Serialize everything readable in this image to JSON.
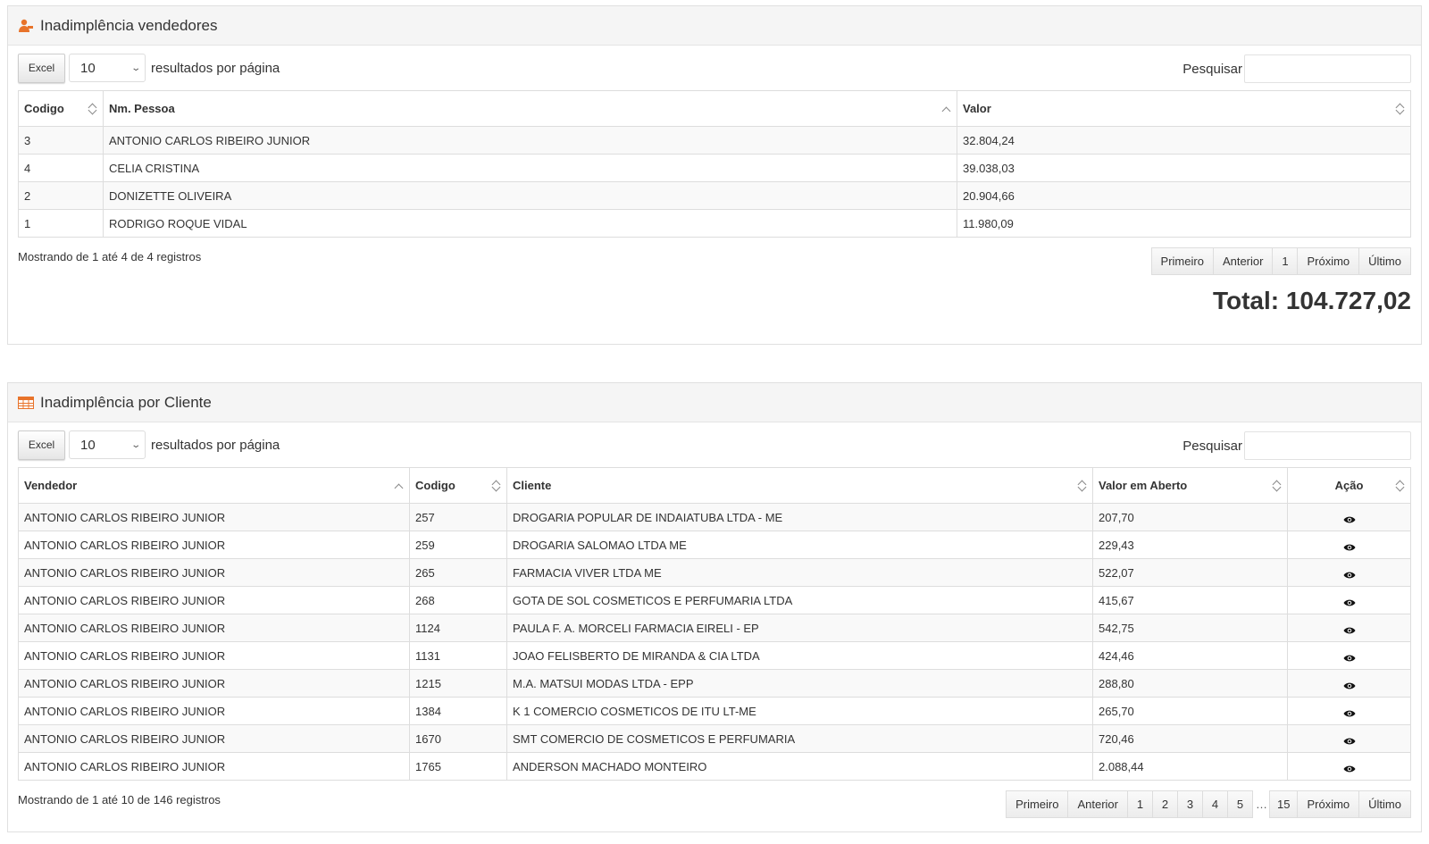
{
  "vendedores": {
    "title": "Inadimplência vendedores",
    "icon": "user-icon",
    "excel_label": "Excel",
    "page_length": "10",
    "length_label": "resultados por página",
    "search_label": "Pesquisar",
    "search_value": "",
    "columns": [
      "Codigo",
      "Nm. Pessoa",
      "Valor"
    ],
    "rows": [
      [
        "3",
        "ANTONIO CARLOS RIBEIRO JUNIOR",
        "32.804,24"
      ],
      [
        "4",
        "CELIA CRISTINA",
        "39.038,03"
      ],
      [
        "2",
        "DONIZETTE OLIVEIRA",
        "20.904,66"
      ],
      [
        "1",
        "RODRIGO ROQUE VIDAL",
        "11.980,09"
      ]
    ],
    "info": "Mostrando de 1 até 4 de 4 registros",
    "pager": {
      "first": "Primeiro",
      "prev": "Anterior",
      "pages": [
        "1"
      ],
      "next": "Próximo",
      "last": "Último"
    },
    "total": "Total: 104.727,02"
  },
  "clientes": {
    "title": "Inadimplência por Cliente",
    "icon": "table-icon",
    "excel_label": "Excel",
    "page_length": "10",
    "length_label": "resultados por página",
    "search_label": "Pesquisar",
    "search_value": "",
    "columns": [
      "Vendedor",
      "Codigo",
      "Cliente",
      "Valor em Aberto",
      "Ação"
    ],
    "rows": [
      [
        "ANTONIO CARLOS RIBEIRO JUNIOR",
        "257",
        "DROGARIA POPULAR DE INDAIATUBA LTDA - ME",
        "207,70"
      ],
      [
        "ANTONIO CARLOS RIBEIRO JUNIOR",
        "259",
        "DROGARIA SALOMAO LTDA ME",
        "229,43"
      ],
      [
        "ANTONIO CARLOS RIBEIRO JUNIOR",
        "265",
        "FARMACIA VIVER LTDA ME",
        "522,07"
      ],
      [
        "ANTONIO CARLOS RIBEIRO JUNIOR",
        "268",
        "GOTA DE SOL COSMETICOS E PERFUMARIA LTDA",
        "415,67"
      ],
      [
        "ANTONIO CARLOS RIBEIRO JUNIOR",
        "1124",
        "PAULA F. A. MORCELI FARMACIA EIRELI - EP",
        "542,75"
      ],
      [
        "ANTONIO CARLOS RIBEIRO JUNIOR",
        "1131",
        "JOAO FELISBERTO DE MIRANDA & CIA LTDA",
        "424,46"
      ],
      [
        "ANTONIO CARLOS RIBEIRO JUNIOR",
        "1215",
        "M.A. MATSUI MODAS LTDA - EPP",
        "288,80"
      ],
      [
        "ANTONIO CARLOS RIBEIRO JUNIOR",
        "1384",
        "K 1 COMERCIO COSMETICOS DE ITU LT-ME",
        "265,70"
      ],
      [
        "ANTONIO CARLOS RIBEIRO JUNIOR",
        "1670",
        "SMT COMERCIO DE COSMETICOS E PERFUMARIA",
        "720,46"
      ],
      [
        "ANTONIO CARLOS RIBEIRO JUNIOR",
        "1765",
        "ANDERSON MACHADO MONTEIRO",
        "2.088,44"
      ]
    ],
    "action_icon": "eye-icon",
    "info": "Mostrando de 1 até 10 de 146 registros",
    "pager": {
      "first": "Primeiro",
      "prev": "Anterior",
      "pages": [
        "1",
        "2",
        "3",
        "4",
        "5"
      ],
      "ellipsis": "…",
      "last_page": "15",
      "next": "Próximo",
      "last": "Último"
    }
  },
  "colors": {
    "accent_orange": "#e8732a",
    "header_bg": "#f5f5f5",
    "border": "#dddddd"
  }
}
